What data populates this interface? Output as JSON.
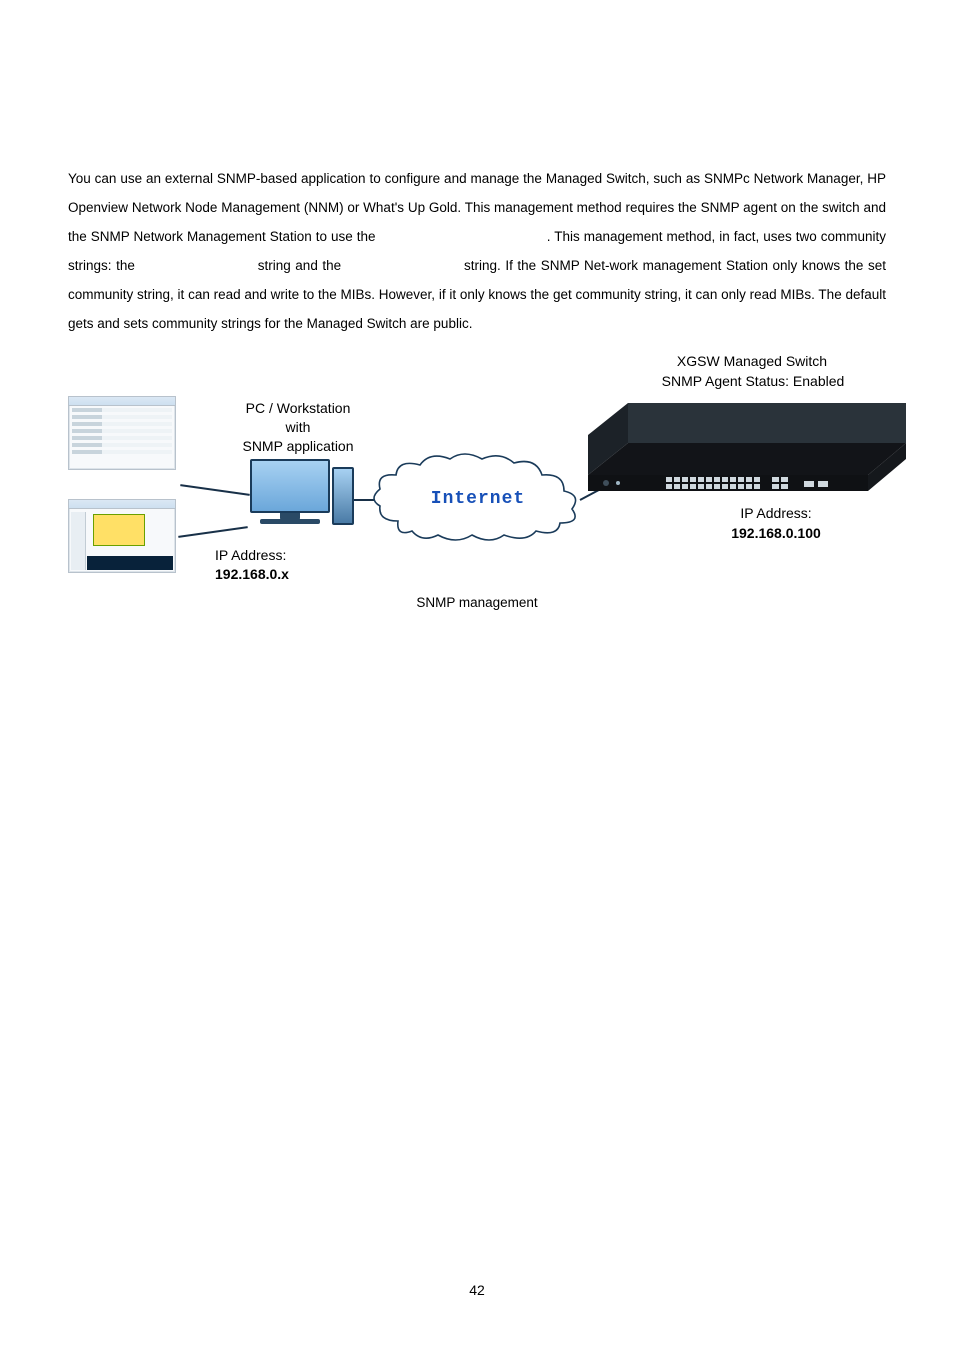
{
  "body": {
    "paragraph": "You can use an external SNMP-based application to configure and manage the Managed Switch, such as SNMPc Network Manager, HP Openview Network Node Management (NNM) or What's Up Gold. This management method requires the SNMP agent on the switch and the SNMP Network Management Station to use the                                           . This management method, in fact, uses two community strings: the                           string and the                           string. If the SNMP Net-work management Station only knows the set community string, it can read and write to the MIBs. However, if it only knows the get community string, it can only read MIBs. The default gets and sets community strings for the Managed Switch are public."
  },
  "figure": {
    "switch_title": "XGSW Managed Switch",
    "switch_status": "SNMP Agent Status: Enabled",
    "pc_line1": "PC / Workstation",
    "pc_line2": "with",
    "pc_line3": "SNMP application",
    "cloud_label": "Internet",
    "ip_left_label": "IP Address:",
    "ip_left_value": "192.168.0.x",
    "ip_right_label": "IP Address:",
    "ip_right_value": "192.168.0.100",
    "caption": "SNMP management"
  },
  "page_number": "42"
}
